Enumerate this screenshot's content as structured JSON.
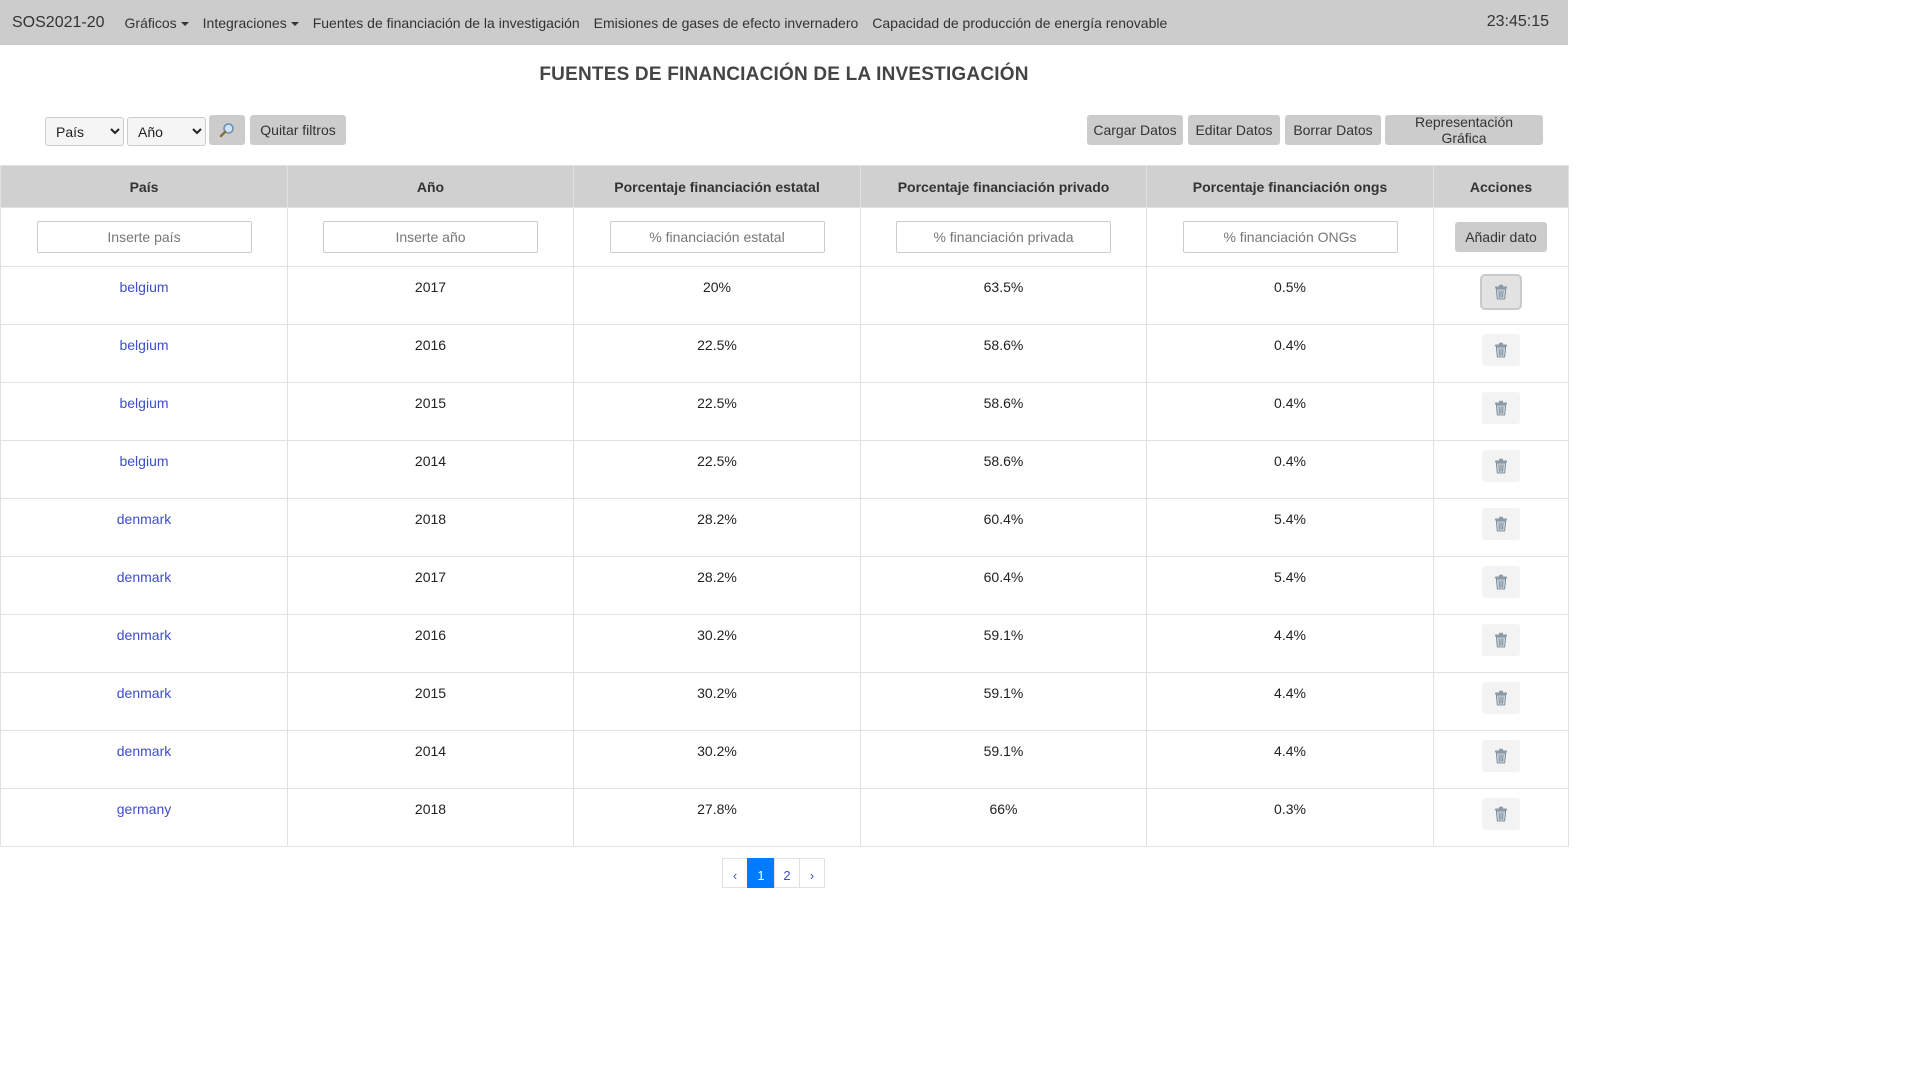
{
  "navbar": {
    "brand": "SOS2021-20",
    "items": [
      {
        "label": "Gráficos",
        "dropdown": true
      },
      {
        "label": "Integraciones",
        "dropdown": true
      },
      {
        "label": "Fuentes de financiación de la investigación",
        "dropdown": false
      },
      {
        "label": "Emisiones de gases de efecto invernadero",
        "dropdown": false
      },
      {
        "label": "Capacidad de producción de energía renovable",
        "dropdown": false
      }
    ],
    "clock": "23:45:15"
  },
  "page_title": "FUENTES DE FINANCIACIÓN DE LA INVESTIGACIÓN",
  "filters": {
    "country_select": "País",
    "year_select": "Año",
    "search_icon": "magnifier-icon",
    "clear_label": "Quitar filtros"
  },
  "actions": {
    "load": "Cargar Datos",
    "edit": "Editar Datos",
    "delete": "Borrar Datos",
    "chart": "Representación Gráfica"
  },
  "table": {
    "headers": [
      "País",
      "Año",
      "Porcentaje financiación estatal",
      "Porcentaje financiación privado",
      "Porcentaje financiación ongs",
      "Acciones"
    ],
    "placeholders": [
      "Inserte país",
      "Inserte año",
      "% financiación estatal",
      "% financiación privada",
      "% financiación ONGs"
    ],
    "add_label": "Añadir dato",
    "delete_icon": "trash-icon",
    "rows": [
      {
        "country": "belgium",
        "year": "2017",
        "state": "20%",
        "private": "63.5%",
        "ngo": "0.5%"
      },
      {
        "country": "belgium",
        "year": "2016",
        "state": "22.5%",
        "private": "58.6%",
        "ngo": "0.4%"
      },
      {
        "country": "belgium",
        "year": "2015",
        "state": "22.5%",
        "private": "58.6%",
        "ngo": "0.4%"
      },
      {
        "country": "belgium",
        "year": "2014",
        "state": "22.5%",
        "private": "58.6%",
        "ngo": "0.4%"
      },
      {
        "country": "denmark",
        "year": "2018",
        "state": "28.2%",
        "private": "60.4%",
        "ngo": "5.4%"
      },
      {
        "country": "denmark",
        "year": "2017",
        "state": "28.2%",
        "private": "60.4%",
        "ngo": "5.4%"
      },
      {
        "country": "denmark",
        "year": "2016",
        "state": "30.2%",
        "private": "59.1%",
        "ngo": "4.4%"
      },
      {
        "country": "denmark",
        "year": "2015",
        "state": "30.2%",
        "private": "59.1%",
        "ngo": "4.4%"
      },
      {
        "country": "denmark",
        "year": "2014",
        "state": "30.2%",
        "private": "59.1%",
        "ngo": "4.4%"
      },
      {
        "country": "germany",
        "year": "2018",
        "state": "27.8%",
        "private": "66%",
        "ngo": "0.3%"
      }
    ]
  },
  "pagination": {
    "prev": "‹",
    "pages": [
      "1",
      "2"
    ],
    "active": "1",
    "next": "›"
  }
}
